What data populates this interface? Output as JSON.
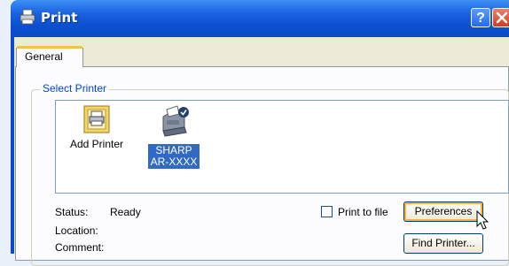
{
  "window": {
    "title": "Print",
    "help_label": "?"
  },
  "tabs": [
    {
      "label": "General",
      "selected": true
    }
  ],
  "select_printer": {
    "group_label": "Select Printer",
    "items": [
      {
        "label": "Add Printer",
        "icon": "add-printer-icon",
        "selected": false
      },
      {
        "label_line1": "SHARP",
        "label_line2": "AR-XXXX",
        "icon": "printer-icon",
        "selected": true
      }
    ]
  },
  "details": {
    "status_label": "Status:",
    "status_value": "Ready",
    "location_label": "Location:",
    "comment_label": "Comment:"
  },
  "print_to_file": {
    "label": "Print to file",
    "checked": false
  },
  "buttons": {
    "preferences": "Preferences",
    "find_printer": "Find Printer..."
  },
  "colors": {
    "titlebar": "#0a4cc8",
    "selection": "#316ac5",
    "group_label": "#0046d5",
    "tab_highlight": "#f3c04a"
  }
}
